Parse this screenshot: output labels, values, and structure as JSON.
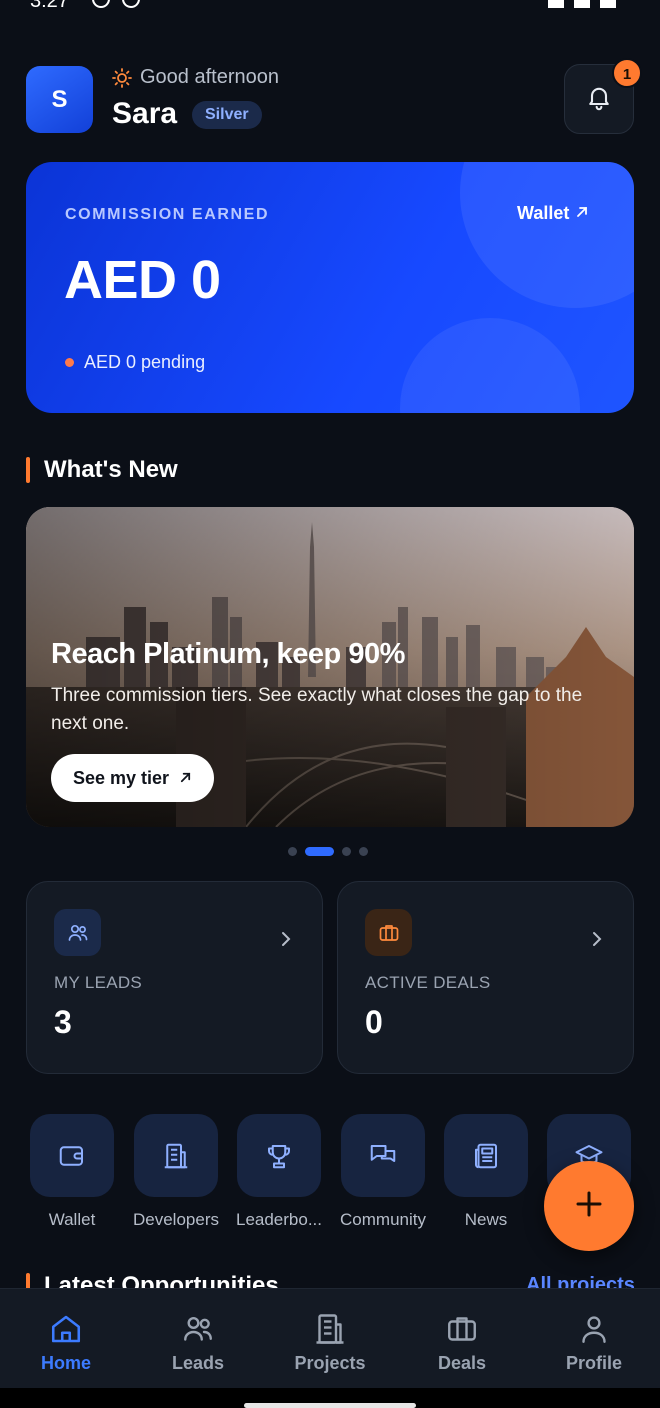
{
  "status_bar": {
    "time": "3:27"
  },
  "header": {
    "avatar_initial": "S",
    "greeting": "Good afternoon",
    "user_name": "Sara",
    "tier": "Silver",
    "notification_count": "1"
  },
  "commission": {
    "label": "COMMISSION EARNED",
    "wallet_link": "Wallet",
    "amount": "AED 0",
    "pending": "AED 0 pending"
  },
  "whats_new": {
    "heading": "What's New",
    "banner": {
      "title": "Reach Platinum, keep 90%",
      "description": "Three commission tiers. See exactly what closes the gap to the next one.",
      "button_label": "See my tier"
    },
    "carousel": {
      "total": 4,
      "active_index": 1
    }
  },
  "stats": [
    {
      "label": "MY LEADS",
      "value": "3",
      "icon": "users-icon"
    },
    {
      "label": "ACTIVE DEALS",
      "value": "0",
      "icon": "briefcase-icon"
    }
  ],
  "quick_actions": [
    {
      "label": "Wallet",
      "icon": "wallet-icon"
    },
    {
      "label": "Developers",
      "icon": "building-icon"
    },
    {
      "label": "Leaderbo...",
      "icon": "trophy-icon"
    },
    {
      "label": "Community",
      "icon": "chat-icon"
    },
    {
      "label": "News",
      "icon": "newspaper-icon"
    },
    {
      "label": "",
      "icon": "graduation-cap-icon"
    }
  ],
  "latest": {
    "heading": "Latest Opportunities",
    "link": "All projects"
  },
  "bottom_nav": [
    {
      "label": "Home",
      "icon": "home-icon",
      "active": true
    },
    {
      "label": "Leads",
      "icon": "users-icon",
      "active": false
    },
    {
      "label": "Projects",
      "icon": "building-icon",
      "active": false
    },
    {
      "label": "Deals",
      "icon": "briefcase-icon",
      "active": false
    },
    {
      "label": "Profile",
      "icon": "person-icon",
      "active": false
    }
  ],
  "colors": {
    "background": "#0b0f17",
    "accent_blue": "#1749ff",
    "accent_orange": "#ff7a2f",
    "card": "#141a24",
    "nav_active": "#3c7bff"
  }
}
